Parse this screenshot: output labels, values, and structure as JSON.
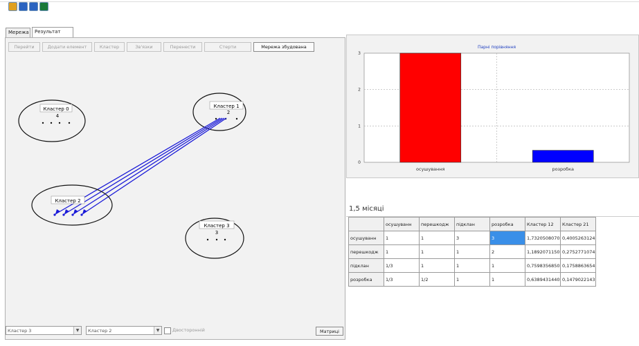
{
  "toolbar": {
    "icons": [
      "open-icon",
      "save-icon",
      "chart-icon",
      "exit-icon"
    ],
    "colors": [
      "#e0a020",
      "#2a63c0",
      "#2a63c0",
      "#1a7a3a"
    ]
  },
  "tabs": [
    "Мережа",
    "Результат"
  ],
  "network_tools": [
    "Перейти",
    "Додати елемент",
    "Кластер",
    "Зв'язки",
    "Перенести",
    "Стерти",
    "Мережа збудована"
  ],
  "clusters": [
    {
      "label": "Кластер 0",
      "value": "4"
    },
    {
      "label": "Кластер 1",
      "value": "2"
    },
    {
      "label": "Кластер 2",
      "value": ""
    },
    {
      "label": "Кластер 3",
      "value": "3"
    }
  ],
  "bottom": {
    "combo1": "Кластер 3",
    "combo2": "Кластер 2",
    "checkbox_label": "Двосторонній",
    "matrix_button": "Матриці"
  },
  "chart_data": {
    "type": "bar",
    "title": "Парні порівняння",
    "categories": [
      "осушування",
      "розробка"
    ],
    "values": [
      3,
      0.33
    ],
    "ylim": [
      0,
      3
    ],
    "yticks": [
      "0",
      "1",
      "2",
      "3"
    ],
    "colors": [
      "#ff0000",
      "#0000ff"
    ],
    "grid": true
  },
  "period_label": "1,5 місяці",
  "matrix": {
    "headers": [
      "",
      "осушуванн",
      "перешкодж",
      "підклан",
      "розробка",
      "Кластер 12",
      "Кластер 21"
    ],
    "rows": [
      [
        "осушуванн",
        "1",
        "1",
        "3",
        "3",
        "1,7320508070",
        "0,4005263124"
      ],
      [
        "перешкодж",
        "1",
        "1",
        "1",
        "2",
        "1,1892071150",
        "0,2752771074"
      ],
      [
        "підклан",
        "1/3",
        "1",
        "1",
        "1",
        "0,7598356850",
        "0,1758863654"
      ],
      [
        "розробка",
        "1/3",
        "1/2",
        "1",
        "1",
        "0,6389431440",
        "0,1479022143"
      ]
    ]
  }
}
